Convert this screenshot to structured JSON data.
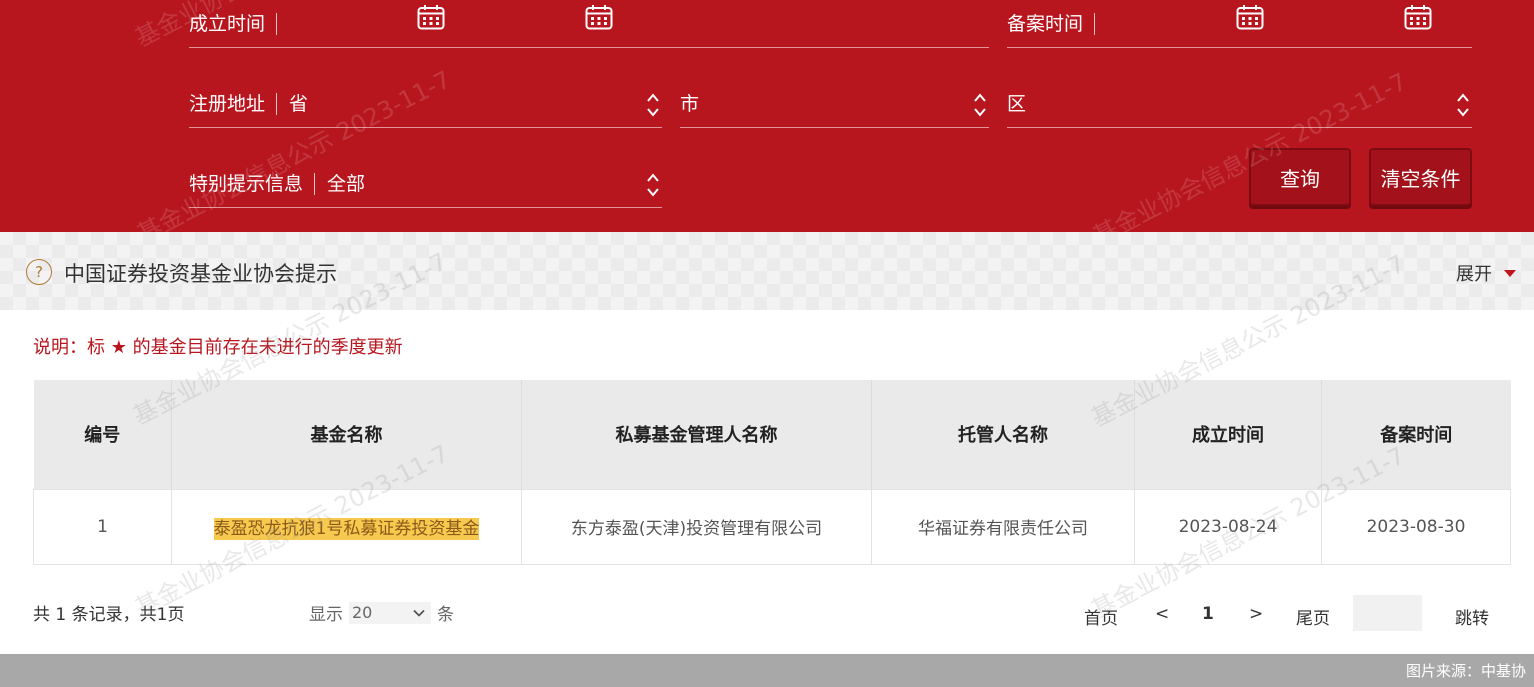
{
  "search": {
    "establish_label": "成立时间",
    "record_label": "备案时间",
    "address_label": "注册地址",
    "province": "省",
    "city": "市",
    "district": "区",
    "special_label": "特别提示信息",
    "special_value": "全部",
    "query_button": "查询",
    "clear_button": "清空条件"
  },
  "tip": {
    "title": "中国证券投资基金业协会提示",
    "expand_label": "展开"
  },
  "note": "说明：标 ★ 的基金目前存在未进行的季度更新",
  "table": {
    "headers": [
      "编号",
      "基金名称",
      "私募基金管理人名称",
      "托管人名称",
      "成立时间",
      "备案时间"
    ],
    "rows": [
      [
        "1",
        "泰盈恐龙抗狼1号私募证券投资基金",
        "东方泰盈(天津)投资管理有限公司",
        "华福证券有限责任公司",
        "2023-08-24",
        "2023-08-30"
      ]
    ]
  },
  "pager": {
    "summary": "共 1 条记录，共1页",
    "show_label": "显示",
    "page_size": "20",
    "unit_label": "条",
    "first": "首页",
    "prev": "<",
    "current": "1",
    "next": ">",
    "last": "尾页",
    "jump": "跳转"
  },
  "watermark": "基金业协会信息公示 2023-11-7",
  "footer": "图片来源：中基协",
  "colors": {
    "primary_red": "#b8161f",
    "highlight": "#f7c94e"
  }
}
